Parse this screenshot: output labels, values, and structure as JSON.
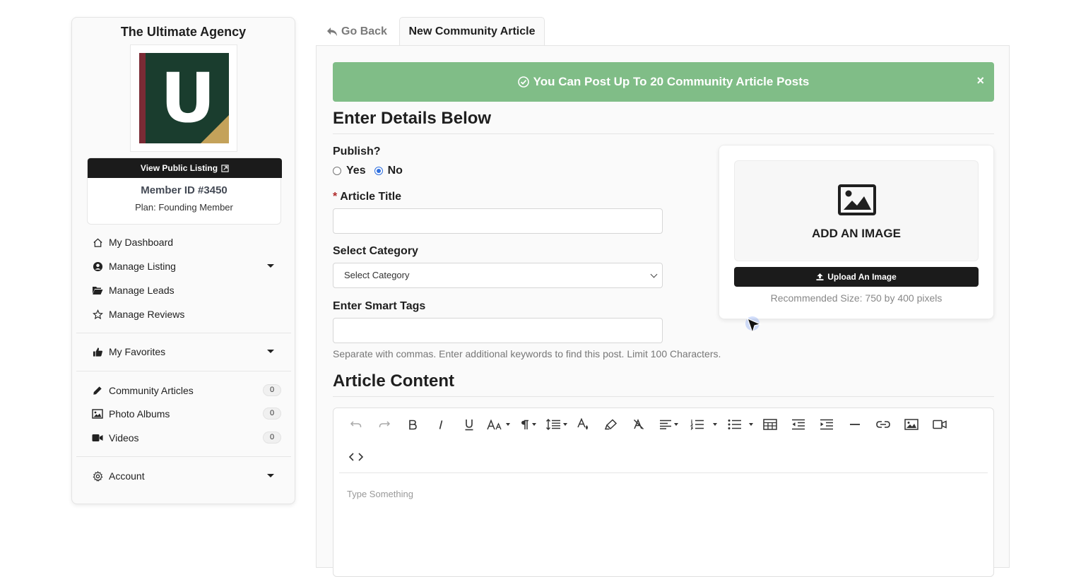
{
  "sidebar": {
    "agency_name": "The Ultimate Agency",
    "logo_letter": "U",
    "view_public_listing": "View Public Listing",
    "member_id": "Member ID #3450",
    "plan": "Plan: Founding Member",
    "nav": [
      {
        "label": "My Dashboard",
        "icon": "home-icon"
      },
      {
        "label": "Manage Listing",
        "icon": "user-circle-icon",
        "dropdown": true
      },
      {
        "label": "Manage Leads",
        "icon": "folder-open-icon"
      },
      {
        "label": "Manage Reviews",
        "icon": "star-icon"
      }
    ],
    "favorites": {
      "label": "My Favorites",
      "icon": "thumbs-up-icon"
    },
    "content": [
      {
        "label": "Community Articles",
        "icon": "pencil-icon",
        "count": "0"
      },
      {
        "label": "Photo Albums",
        "icon": "image-icon",
        "count": "0"
      },
      {
        "label": "Videos",
        "icon": "video-icon",
        "count": "0"
      }
    ],
    "account": {
      "label": "Account",
      "icon": "gear-icon"
    }
  },
  "tabs": {
    "back": "Go Back",
    "active": "New Community Article"
  },
  "alert": {
    "text": "You Can Post Up To 20 Community Article Posts",
    "close": "×",
    "color": "#80bd87"
  },
  "form": {
    "heading": "Enter Details Below",
    "publish_label": "Publish?",
    "publish_yes": "Yes",
    "publish_no": "No",
    "publish_selected": "No",
    "required_mark": "*",
    "title_label": "Article Title",
    "title_value": "",
    "category_label": "Select Category",
    "category_selected": "Select Category",
    "tags_label": "Enter Smart Tags",
    "tags_value": "",
    "tags_help": "Separate with commas. Enter additional keywords to find this post. Limit 100 Characters."
  },
  "image_upload": {
    "drop_text": "ADD AN IMAGE",
    "button": "Upload An Image",
    "recommended": "Recommended Size: 750 by 400 pixels"
  },
  "content": {
    "heading": "Article Content",
    "placeholder": "Type Something"
  },
  "colors": {
    "dark_button": "#1b1b1b",
    "radio_accent": "#2f6fde"
  }
}
